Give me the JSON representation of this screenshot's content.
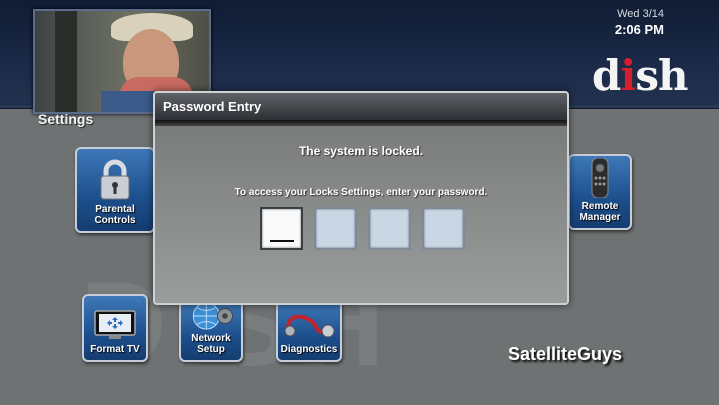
{
  "header": {
    "date": "Wed 3/14",
    "time": "2:06 PM",
    "logo": {
      "before": "d",
      "dot": "i",
      "after": "sh"
    }
  },
  "page": {
    "title": "Settings"
  },
  "tiles": {
    "parental_controls": "Parental Controls",
    "remote_manager": "Remote Manager",
    "format_tv": "Format TV",
    "network_setup": "Network Setup",
    "diagnostics": "Diagnostics"
  },
  "dialog": {
    "title": "Password Entry",
    "message": "The system is locked.",
    "instruction": "To access your Locks Settings, enter your password.",
    "pin_length": 4,
    "active_digit": 1
  },
  "watermark": "SatelliteGuys",
  "colors": {
    "header": "#1a2947",
    "tile": "#1d4f8c",
    "dialog": "#8e8f8e",
    "pin_box": "#c9d6e3",
    "logo_accent": "#d3202e"
  }
}
